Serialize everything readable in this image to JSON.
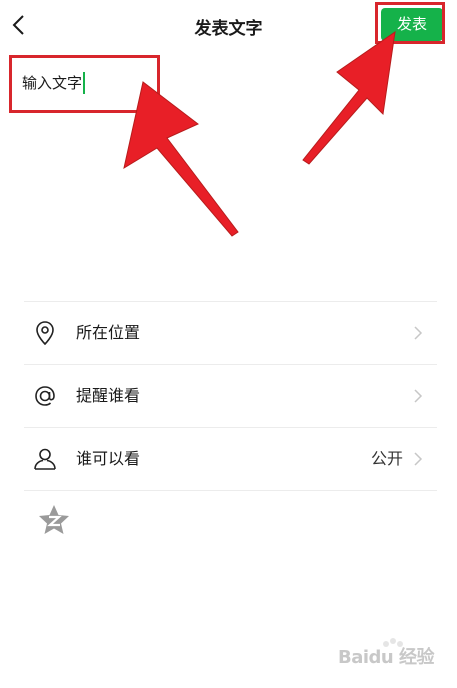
{
  "header": {
    "title": "发表文字",
    "publish_label": "发表"
  },
  "composer": {
    "text": "输入文字"
  },
  "menu": {
    "items": [
      {
        "icon": "location-pin-icon",
        "label": "所在位置",
        "value": ""
      },
      {
        "icon": "at-sign-icon",
        "label": "提醒谁看",
        "value": ""
      },
      {
        "icon": "person-icon",
        "label": "谁可以看",
        "value": "公开"
      }
    ]
  },
  "share": {
    "icon": "qzone-star-icon"
  },
  "watermark": {
    "text": "Baidu 经验"
  },
  "colors": {
    "accent": "#15b24a",
    "annotation": "#d8262c",
    "text": "#1a1a1a",
    "divider": "#ececec"
  }
}
